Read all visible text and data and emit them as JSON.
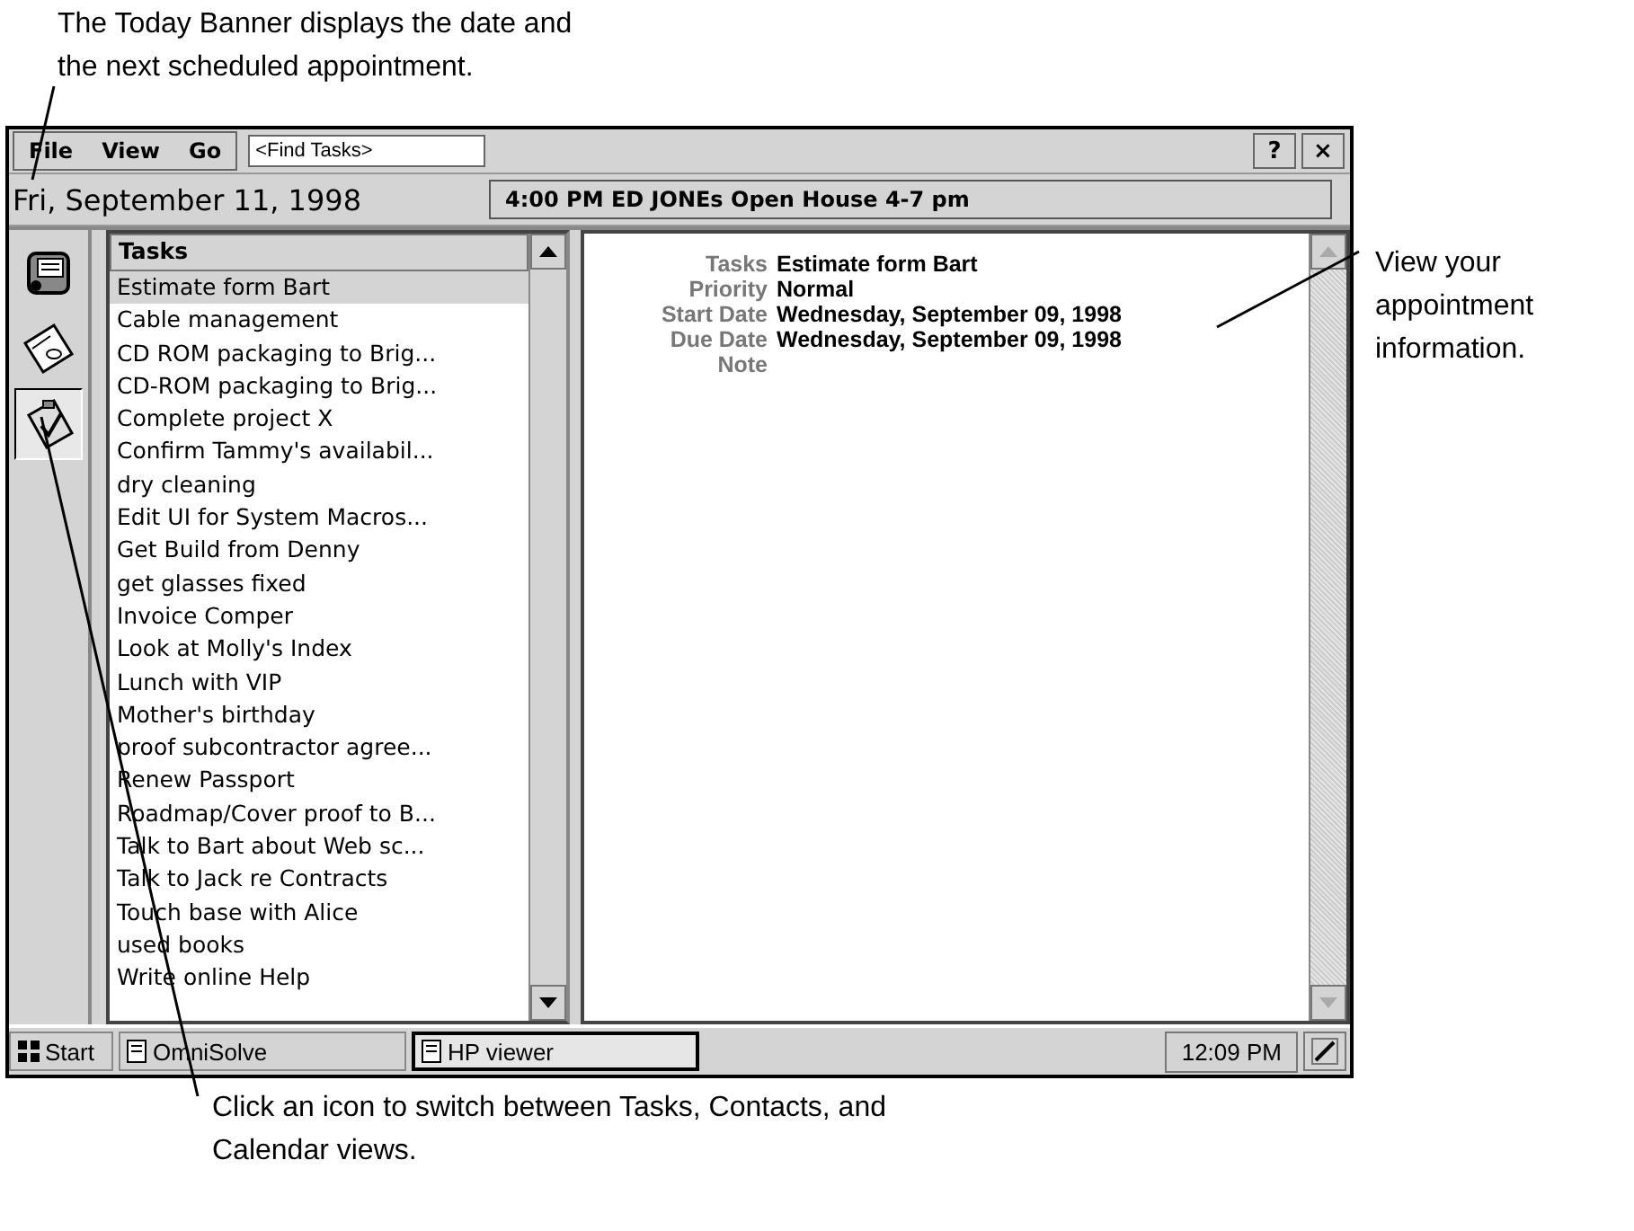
{
  "callouts": {
    "top": "The Today Banner displays the date and the next scheduled appointment.",
    "right": "View your appointment information.",
    "bottom": "Click an icon to switch between Tasks, Contacts, and Calendar views."
  },
  "menu": [
    "File",
    "View",
    "Go"
  ],
  "search": {
    "placeholder": "<Find Tasks>"
  },
  "title_buttons": [
    "?",
    "×"
  ],
  "banner": {
    "date": "Fri, September 11, 1998",
    "appointment": "4:00 PM  ED JONEs Open House  4-7 pm"
  },
  "view_icons": [
    {
      "kind": "calendar",
      "selected": false
    },
    {
      "kind": "contacts",
      "selected": false
    },
    {
      "kind": "tasks",
      "selected": true
    }
  ],
  "task_list": {
    "heading": "Tasks",
    "items": [
      {
        "label": "Estimate form Bart",
        "selected": true
      },
      {
        "label": "Cable management",
        "selected": false
      },
      {
        "label": "CD ROM packaging to Brig...",
        "selected": false
      },
      {
        "label": "CD-ROM packaging to Brig...",
        "selected": false
      },
      {
        "label": "Complete project X",
        "selected": false
      },
      {
        "label": "Confirm Tammy's availabil...",
        "selected": false
      },
      {
        "label": "dry cleaning",
        "selected": false
      },
      {
        "label": "Edit UI for System Macros...",
        "selected": false
      },
      {
        "label": "Get Build from Denny",
        "selected": false
      },
      {
        "label": "get glasses fixed",
        "selected": false
      },
      {
        "label": "Invoice Comper",
        "selected": false
      },
      {
        "label": "Look at Molly's Index",
        "selected": false
      },
      {
        "label": "Lunch with VIP",
        "selected": false
      },
      {
        "label": "Mother's birthday",
        "selected": false
      },
      {
        "label": "proof subcontractor agree...",
        "selected": false
      },
      {
        "label": "Renew Passport",
        "selected": false
      },
      {
        "label": "Roadmap/Cover proof to B...",
        "selected": false
      },
      {
        "label": "Talk to Bart about Web sc...",
        "selected": false
      },
      {
        "label": "Talk to Jack re Contracts",
        "selected": false
      },
      {
        "label": "Touch base with Alice",
        "selected": false
      },
      {
        "label": "used books",
        "selected": false
      },
      {
        "label": "Write online Help",
        "selected": false
      }
    ]
  },
  "details": [
    {
      "label": "Tasks",
      "value": "Estimate form Bart"
    },
    {
      "label": "Priority",
      "value": "Normal"
    },
    {
      "label": "Start Date",
      "value": "Wednesday, September 09, 1998"
    },
    {
      "label": "Due Date",
      "value": "Wednesday, September 09, 1998"
    },
    {
      "label": "Note"
    }
  ],
  "taskbar": {
    "start": "Start",
    "apps": [
      {
        "label": "OmniSolve",
        "selected": false
      },
      {
        "label": "HP viewer",
        "selected": true
      }
    ],
    "clock": "12:09 PM"
  }
}
